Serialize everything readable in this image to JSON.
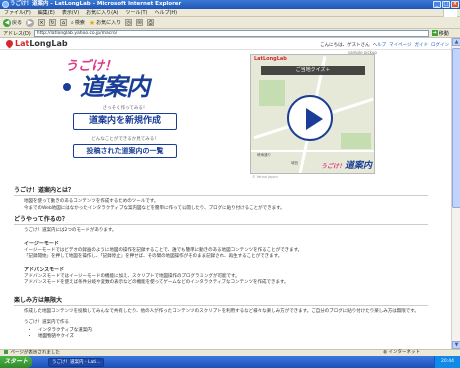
{
  "window": {
    "title": "うごけ！道案内 - LatLongLab - Microsoft Internet Explorer",
    "min_label": "_",
    "max_label": "□",
    "close_label": "×"
  },
  "menu": [
    "ファイル(F)",
    "編集(E)",
    "表示(V)",
    "お気に入り(A)",
    "ツール(T)",
    "ヘルプ(H)"
  ],
  "toolbar": {
    "back_label": "戻る",
    "forward_glyph": "▶",
    "back_glyph": "◀",
    "search_label": "検索",
    "favorites_label": "お気に入り"
  },
  "address": {
    "label": "アドレス(D)",
    "url": "http://latlonglab.yahoo.co.jp/macro/",
    "go_label": "移動",
    "go_glyph": "➔"
  },
  "site": {
    "brand_prefix": "Lat",
    "brand_rest": "LongLab",
    "header_links": [
      "こんにちは、ゲストさん",
      "ヘルプ",
      "マイページ",
      "ガイド",
      "ログイン"
    ]
  },
  "hero": {
    "logo_line1": "うごけ！",
    "logo_line2": "道案内",
    "sub1": "さっそく作ってみる！",
    "create_button": "道案内を新規作成",
    "sub2": "どんなことができるか見てみる！",
    "list_button": "投稿された道案内の一覧",
    "sample_pickup": "sample pickup",
    "quiz_title": "ご当地クイズ＋",
    "map_brand": "LatLongLab",
    "mini_brand1": "うごけ！",
    "mini_brand2": "道案内",
    "street1": "晴海通り",
    "street2": "城西",
    "caption": "© Yahoo Japan"
  },
  "sections": {
    "about_title": "うごけ！道案内とは？",
    "about_text1": "地図を使って動きのあるコンテンツを作成するためのツールです。",
    "about_text2": "今までのWeb地図にはなかったインタラクティブな案内図などを簡単に作って公開したり、ブログに貼り付けることができます。",
    "how_title": "どうやって作るの？",
    "how_text": "うごけ！道案内には2つのモードがあります。",
    "easy_title": "イージーモード",
    "easy_text1": "イージーモードではビデオの録画のように地図の操作を記録することで、誰でも簡単に動きのある地図コンテンツを作ることができます。",
    "easy_text2": "「記録開始」を押して地図を操作し、「記録停止」を押せば、その間の地図操作がそのまま記録され、再生することができます。",
    "adv_title": "アドバンスモード",
    "adv_text1": "アドバンスモードではイージーモードの機能に加え、スクリプトで地図操作のプログラミングが可能です。",
    "adv_text2": "アドバンスモードを使えば条件分岐や変数の表示などの機能を使ってゲームなどのインタラクティブなコンテンツを作成できます。",
    "fun_title": "楽しみ方は無限大",
    "fun_text": "作成した地図コンテンツを投稿してみんなで共有したり、他の人が作ったコンテンツのスクリプトを利用するなど様々な楽しみ方ができます。ご自分のブログに貼り付けたり楽しみ方は無限です。",
    "examples_title": "うごけ！道案内で作る",
    "bullets": [
      "インタラクティブな道案内",
      "地図物語やクイズ"
    ]
  },
  "status": {
    "text": "ページが表示されました",
    "zone": "インターネット"
  },
  "taskbar": {
    "start": "スタート",
    "task_label": "うごけ！道案内 - Lati...",
    "clock": "20:44"
  }
}
